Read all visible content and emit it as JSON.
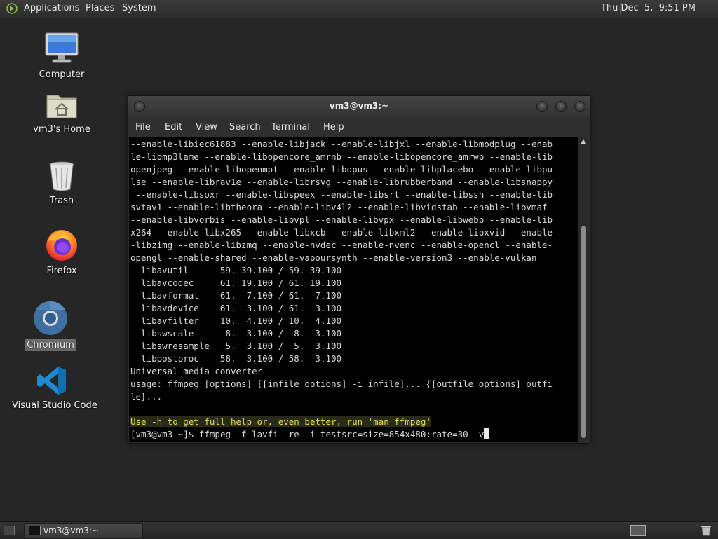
{
  "top_panel": {
    "menus": [
      "Applications",
      "Places",
      "System"
    ],
    "clock": "Thu Dec  5,  9:51 PM"
  },
  "desktop": {
    "icons": [
      {
        "label": "Computer",
        "icon": "computer-icon"
      },
      {
        "label": "vm3's Home",
        "icon": "home-folder-icon"
      },
      {
        "label": "Trash",
        "icon": "trash-icon"
      },
      {
        "label": "Firefox",
        "icon": "firefox-icon"
      },
      {
        "label": "Chromium",
        "icon": "chromium-icon",
        "selected": true
      },
      {
        "label": "Visual Studio Code",
        "icon": "vscode-icon"
      }
    ]
  },
  "terminal": {
    "title": "vm3@vm3:~",
    "menu": [
      "File",
      "Edit",
      "View",
      "Search",
      "Terminal",
      "Help"
    ],
    "lines": [
      "--enable-libiec61883 --enable-libjack --enable-libjxl --enable-libmodplug --enab",
      "le-libmp3lame --enable-libopencore_amrnb --enable-libopencore_amrwb --enable-lib",
      "openjpeg --enable-libopenmpt --enable-libopus --enable-libplacebo --enable-libpu",
      "lse --enable-librav1e --enable-librsvg --enable-librubberband --enable-libsnappy",
      " --enable-libsoxr --enable-libspeex --enable-libsrt --enable-libssh --enable-lib",
      "svtav1 --enable-libtheora --enable-libv4l2 --enable-libvidstab --enable-libvmaf",
      "--enable-libvorbis --enable-libvpl --enable-libvpx --enable-libwebp --enable-lib",
      "x264 --enable-libx265 --enable-libxcb --enable-libxml2 --enable-libxvid --enable",
      "-libzimg --enable-libzmq --enable-nvdec --enable-nvenc --enable-opencl --enable-",
      "opengl --enable-shared --enable-vapoursynth --enable-version3 --enable-vulkan",
      "  libavutil      59. 39.100 / 59. 39.100",
      "  libavcodec     61. 19.100 / 61. 19.100",
      "  libavformat    61.  7.100 / 61.  7.100",
      "  libavdevice    61.  3.100 / 61.  3.100",
      "  libavfilter    10.  4.100 / 10.  4.100",
      "  libswscale      8.  3.100 /  8.  3.100",
      "  libswresample   5.  3.100 /  5.  3.100",
      "  libpostproc    58.  3.100 / 58.  3.100",
      "Universal media converter",
      "usage: ffmpeg [options] [[infile options] -i infile]... {[outfile options] outfi",
      "le}...",
      ""
    ],
    "hint_line": "Use -h to get full help or, even better, run 'man ffmpeg'",
    "prompt": "[vm3@vm3 ~]$ ",
    "command": "ffmpeg -f lavfi -re -i testsrc=size=854x480:rate=30 -v"
  },
  "bottom_panel": {
    "task": "vm3@vm3:~"
  }
}
